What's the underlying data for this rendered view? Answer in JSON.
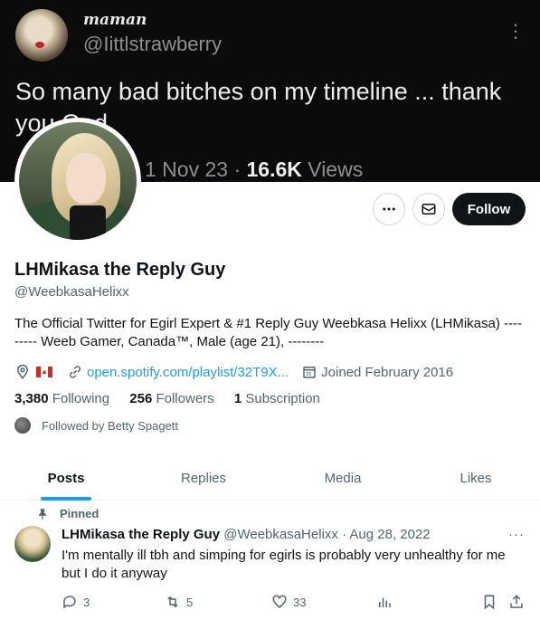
{
  "banner": {
    "name": "maman",
    "handle": "@Iittlstrawberry",
    "tweet_text": "So many bad bitches on my timeline ... thank you God",
    "date": "1 Nov 23 ·",
    "views_count": "16.6K",
    "views_label": "Views"
  },
  "actions": {
    "follow_label": "Follow"
  },
  "profile": {
    "display_name": "LHMikasa the Reply Guy",
    "handle": "@WeebkasaHelixx",
    "bio": "The Official Twitter for Egirl Expert & #1 Reply Guy Weebkasa Helixx (LHMikasa) --------- Weeb Gamer, Canada™, Male (age 21), --------",
    "website": "open.spotify.com/playlist/32T9X...",
    "joined": "Joined February 2016",
    "following_count": "3,380",
    "following_label": "Following",
    "followers_count": "256",
    "followers_label": "Followers",
    "subscription_count": "1",
    "subscription_label": "Subscription",
    "followed_by": "Followed by Betty Spagett"
  },
  "tabs": [
    {
      "label": "Posts",
      "active": true
    },
    {
      "label": "Replies",
      "active": false
    },
    {
      "label": "Media",
      "active": false
    },
    {
      "label": "Likes",
      "active": false
    }
  ],
  "tweet": {
    "pinned_label": "Pinned",
    "author_name": "LHMikasa the Reply Guy",
    "author_handle_date": "@WeebkasaHelixx · Aug 28, 2022",
    "text": "I'm mentally ill tbh and simping for egirls is probably very unhealthy for me but I do it anyway",
    "replies": "3",
    "retweets": "5",
    "likes": "33"
  },
  "colors": {
    "accent": "#1d9bf0",
    "text_primary": "#0f1419",
    "text_secondary": "#536471",
    "follow_button_bg": "#0f1419"
  }
}
